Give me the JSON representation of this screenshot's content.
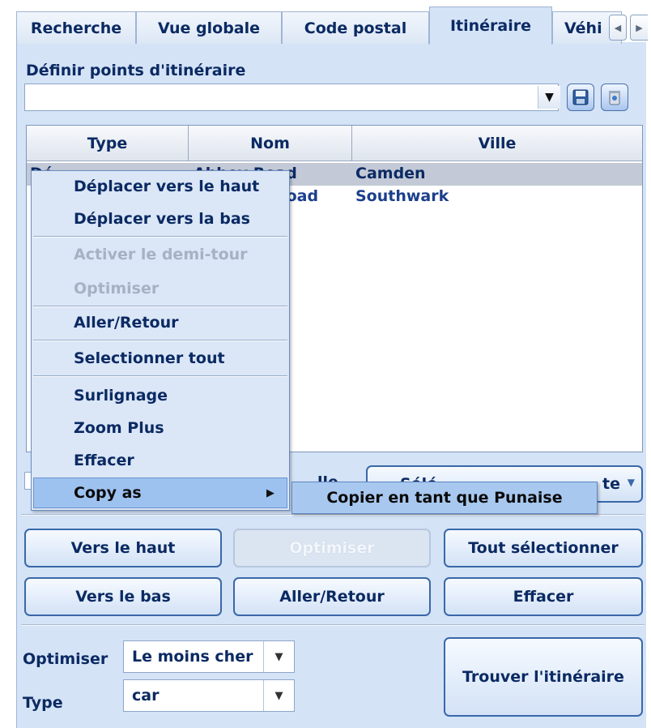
{
  "tabs": [
    "Recherche",
    "Vue globale",
    "Code postal",
    "Itinéraire",
    "Véhi"
  ],
  "active_tab": "Itinéraire",
  "waypoints_label": "Définir points d'itinéraire",
  "waypoints_value": "",
  "table": {
    "headers": [
      "Type",
      "Nom",
      "Ville"
    ],
    "rows": [
      {
        "type": "Dé",
        "nom": "Abbey Road",
        "ville": "Camden",
        "selected": true
      },
      {
        "type": "",
        "nom": "Road",
        "ville": "Southwark",
        "selected": false
      }
    ]
  },
  "hidden_partial": {
    "label_fragment": "lle",
    "dropdown_fragment": "Sélé",
    "dropdown_tail": "te"
  },
  "context_menu": {
    "items": [
      {
        "label": "Déplacer vers le haut",
        "enabled": true
      },
      {
        "label": "Déplacer vers la bas",
        "enabled": true
      },
      {
        "label": "Activer le demi-tour",
        "enabled": false
      },
      {
        "label": "Optimiser",
        "enabled": false
      },
      {
        "label": "Aller/Retour",
        "enabled": true
      },
      {
        "label": "Selectionner tout",
        "enabled": true
      },
      {
        "label": "Surlignage",
        "enabled": true
      },
      {
        "label": "Zoom Plus",
        "enabled": true
      },
      {
        "label": "Effacer",
        "enabled": true
      },
      {
        "label": "Copy as",
        "enabled": true,
        "submenu": true
      }
    ],
    "submenu_item": "Copier en tant que Punaise"
  },
  "buttons": {
    "up": "Vers le haut",
    "optimize": "Optimiser",
    "select_all": "Tout sélectionner",
    "down": "Vers le bas",
    "round_trip": "Aller/Retour",
    "clear": "Effacer",
    "find_route": "Trouver l'itinéraire"
  },
  "options": {
    "optimize_label": "Optimiser",
    "optimize_value": "Le moins cher",
    "type_label": "Type",
    "type_value": "car"
  },
  "icons": {
    "combo_arrow": "dropdown-arrow",
    "save": "save-icon",
    "clear_list": "trash-icon",
    "submenu_arrow": "submenu-arrow"
  },
  "colors": {
    "panel_bg": "#d4e3f6",
    "text": "#0b2a63",
    "accent_border": "#3a68a8",
    "menu_highlight": "#9ec2f0"
  }
}
